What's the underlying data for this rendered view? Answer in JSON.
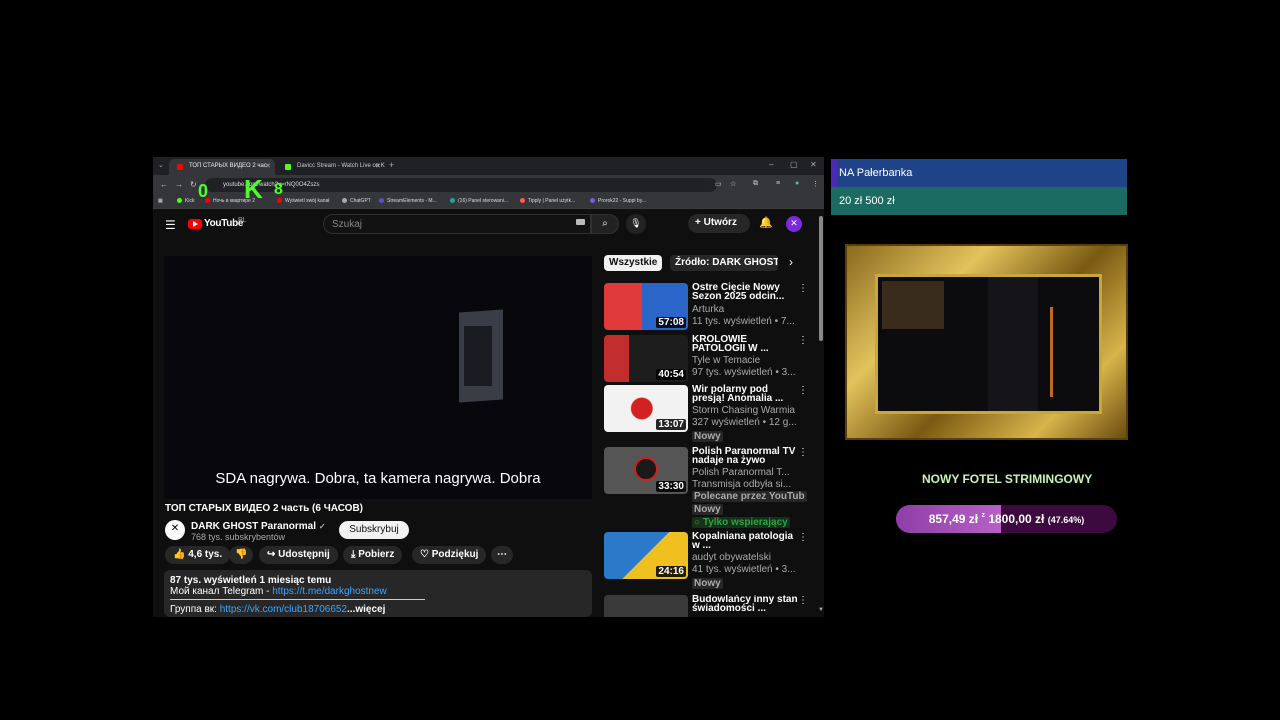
{
  "browser": {
    "tabs": [
      {
        "title": "ТОП СТАРЫХ ВИДЕО 2 час",
        "favicon_color": "#ff0000",
        "active": true
      },
      {
        "title": "Davicc Stream - Watch Live on K",
        "favicon_color": "#53fc18",
        "active": false
      }
    ],
    "address": "youtube.com/watch?v=rNQ0O4Zszs",
    "bookmarks": [
      {
        "label": "Kick",
        "color": "#53fc18"
      },
      {
        "label": "Ночь в квартире 2",
        "color": "#ff0000"
      },
      {
        "label": "Wyświetl swój kanał",
        "color": "#ff0000"
      },
      {
        "label": "ChatGPT",
        "color": "#aaaaaa"
      },
      {
        "label": "StreamElements - M...",
        "color": "#5a4fcf"
      },
      {
        "label": "(16) Panel sterowani...",
        "color": "#2aa198"
      },
      {
        "label": "Tipply | Panel użytk...",
        "color": "#ff5a5a"
      },
      {
        "label": "Prorok22 - Suppi by...",
        "color": "#7b5bd6"
      }
    ],
    "overlay_chars": {
      "a": "0",
      "b": "K",
      "c": "8"
    }
  },
  "youtube": {
    "logo_text": "YouTube",
    "country": "PL",
    "search_placeholder": "Szukaj",
    "create_label": "+ Utwórz",
    "avatar_glyph": "✕",
    "player": {
      "subtitle": "SDA nagrywa. Dobra, ta kamera nagrywa. Dobra"
    },
    "video": {
      "title": "ТОП СТАРЫХ ВИДЕО 2 часть (6 ЧАСОВ)",
      "channel": "DARK GHOST Paranormal",
      "verified": "✓",
      "subscribers": "768 tys. subskrybentów",
      "subscribe_label": "Subskrybuj",
      "likes": "👍 4,6 tys.",
      "dislike": "👎",
      "share": "↪ Udostępnij",
      "download": "⤓ Pobierz",
      "thanks": "♡ Podziękuj",
      "more": "⋯"
    },
    "description": {
      "stats": "87 tys. wyświetleń  1 miesiąc temu",
      "line2_prefix": "Мой канал Telegram - ",
      "line2_link": "https://t.me/darkghostnew",
      "line3_prefix": "Группа вк: ",
      "line3_link": "https://vk.com/club18706652",
      "more_label": "...więcej"
    },
    "chips": [
      "Wszystkie",
      "Źródło: DARK GHOST"
    ],
    "recommendations": [
      {
        "title": "Ostre Cięcie Nowy Sezon 2025 odcin...",
        "channel": "Arturka",
        "meta": "11 tys. wyświetleń • 7...",
        "duration": "57:08",
        "badges": [],
        "thumb_colors": [
          "#e03a3a",
          "#2a66c9"
        ]
      },
      {
        "title": "KROLOWIE PATOLOGII W ...",
        "channel": "Tyle w Temacie",
        "meta": "97 tys. wyświetleń • 3...",
        "duration": "40:54",
        "badges": [],
        "thumb_colors": [
          "#c22e2e",
          "#1d1d1d"
        ]
      },
      {
        "title": "Wir polarny pod presją! Anomalia ...",
        "channel": "Storm Chasing Warmia",
        "meta": "327 wyświetleń • 12 g...",
        "duration": "13:07",
        "badges": [
          "Nowy"
        ],
        "thumb_colors": [
          "#f2f2f2",
          "#d32020"
        ]
      },
      {
        "title": "Polish Paranormal TV nadaje na żywo",
        "channel": "Polish Paranormal T...",
        "meta": "Transmisja odbyła si...",
        "meta2": "Polecane przez YouTub",
        "duration": "33:30",
        "badges": [
          "Nowy",
          "Tylko wspierający"
        ],
        "thumb_colors": [
          "#555555",
          "#888888"
        ]
      },
      {
        "title": "Kopalniana patologia w ...",
        "channel": "audyt obywatelski",
        "meta": "41 tys. wyświetleń • 3...",
        "duration": "24:16",
        "badges": [
          "Nowy"
        ],
        "thumb_colors": [
          "#2a7ac9",
          "#f0c020"
        ]
      },
      {
        "title": "Budowlańcy inny stan świadomości ...",
        "channel": "",
        "meta": "",
        "duration": "",
        "badges": [],
        "thumb_colors": [
          "#333333",
          "#777777"
        ]
      }
    ]
  },
  "stream_overlay": {
    "tip_from": "NA Pałerbanka",
    "tip_amount": "20 zł 500 zł",
    "goal_title": "NOWY FOTEL STRIMINGOWY",
    "goal_current": "857,49 zł",
    "goal_separator": "z",
    "goal_target": "1800,00 zł",
    "goal_percent": "(47.64%)",
    "goal_fraction": 0.4764,
    "colors": {
      "tip_banner": "#1f4389",
      "tip_amount_bg": "#1c6b63",
      "goal_bar_bg": "#3d0a3f",
      "goal_fill": "#a14fb8",
      "goal_title_color": "#c6f7b1"
    }
  }
}
